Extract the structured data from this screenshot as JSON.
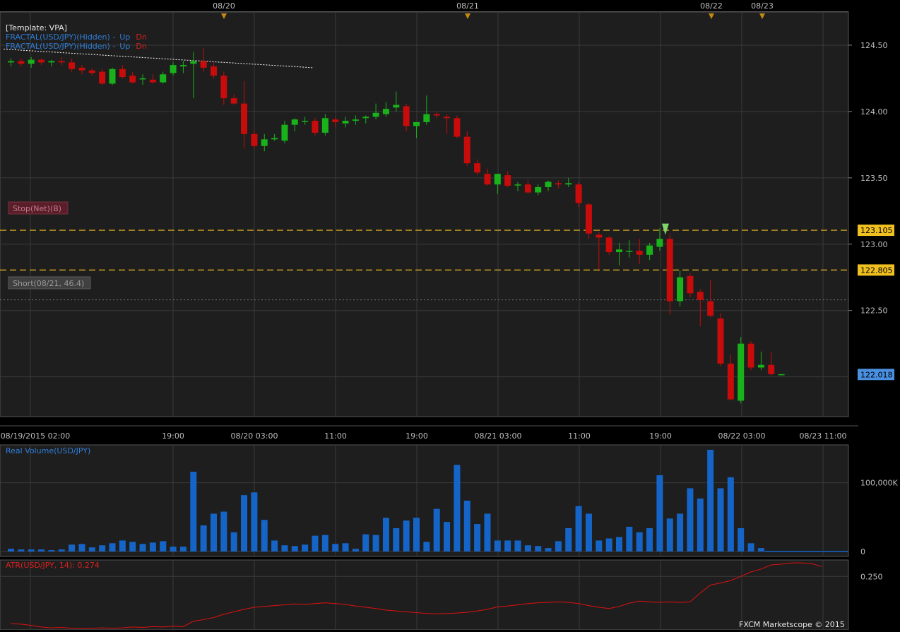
{
  "colors": {
    "background": "#000000",
    "panel": "#1e1e1e",
    "grid": "#3a3a3a",
    "border": "#555555",
    "up": "#19b21b",
    "down": "#c80b0b",
    "volume": "#1565c8",
    "atr": "#e01010",
    "level_line": "#f0c020",
    "price_badge": "#4a90e2",
    "text": "#bdbdbd",
    "marker": "#c28a10"
  },
  "top_dates": [
    "08/20",
    "08/21",
    "08/22",
    "08/23"
  ],
  "legend": {
    "template": "[Template: VPA]",
    "fractal_1": "FRACTAL(USD/JPY)(Hidden) -",
    "fractal_2": "FRACTAL(USD/JPY)(Hidden) -",
    "up": "Up",
    "dn": "Dn"
  },
  "orders": {
    "stop": "Stop(Net)(B)",
    "short": "Short(08/21, 46.4)"
  },
  "volume_title": "Real Volume(USD/JPY)",
  "atr_title": "ATR(USD/JPY, 14): 0.274",
  "watermark": "FXCM Marketscope © 2015",
  "chart_data": [
    {
      "type": "candlestick",
      "symbol": "USD/JPY",
      "x_labels": [
        "08/19/2015 02:00",
        "19:00",
        "08/20 03:00",
        "11:00",
        "19:00",
        "08/21 03:00",
        "11:00",
        "19:00",
        "08/22 03:00",
        "08/23 11:00"
      ],
      "y_ticks": [
        "124.50",
        "124.00",
        "123.50",
        "123.00",
        "122.50"
      ],
      "ylim": [
        121.7,
        124.75
      ],
      "levels": [
        {
          "label": "123.105",
          "value": 123.105
        },
        {
          "label": "122.805",
          "value": 122.805
        }
      ],
      "entry_level": 122.58,
      "last_price": "122.018",
      "candles": [
        [
          124.37,
          124.4,
          124.34,
          124.38
        ],
        [
          124.38,
          124.4,
          124.34,
          124.36
        ],
        [
          124.36,
          124.41,
          124.33,
          124.39
        ],
        [
          124.39,
          124.4,
          124.35,
          124.37
        ],
        [
          124.37,
          124.39,
          124.34,
          124.38
        ],
        [
          124.38,
          124.41,
          124.35,
          124.37
        ],
        [
          124.37,
          124.4,
          124.3,
          124.32
        ],
        [
          124.33,
          124.35,
          124.28,
          124.31
        ],
        [
          124.31,
          124.33,
          124.27,
          124.29
        ],
        [
          124.3,
          124.32,
          124.2,
          124.21
        ],
        [
          124.21,
          124.33,
          124.2,
          124.32
        ],
        [
          124.32,
          124.35,
          124.25,
          124.26
        ],
        [
          124.27,
          124.3,
          124.21,
          124.22
        ],
        [
          124.25,
          124.28,
          124.2,
          124.25
        ],
        [
          124.24,
          124.28,
          124.21,
          124.22
        ],
        [
          124.22,
          124.3,
          124.21,
          124.28
        ],
        [
          124.29,
          124.37,
          124.27,
          124.35
        ],
        [
          124.34,
          124.38,
          124.29,
          124.35
        ],
        [
          124.36,
          124.45,
          124.1,
          124.38
        ],
        [
          124.38,
          124.48,
          124.3,
          124.33
        ],
        [
          124.34,
          124.37,
          124.25,
          124.27
        ],
        [
          124.27,
          124.3,
          124.05,
          124.1
        ],
        [
          124.1,
          124.13,
          124.05,
          124.06
        ],
        [
          124.06,
          124.23,
          123.72,
          123.83
        ],
        [
          123.83,
          123.86,
          123.72,
          123.74
        ],
        [
          123.74,
          123.83,
          123.7,
          123.79
        ],
        [
          123.79,
          123.83,
          123.78,
          123.8
        ],
        [
          123.78,
          123.93,
          123.76,
          123.9
        ],
        [
          123.9,
          123.95,
          123.85,
          123.94
        ],
        [
          123.93,
          123.96,
          123.9,
          123.93
        ],
        [
          123.93,
          123.95,
          123.82,
          123.84
        ],
        [
          123.84,
          123.98,
          123.82,
          123.95
        ],
        [
          123.94,
          123.96,
          123.88,
          123.92
        ],
        [
          123.91,
          123.96,
          123.88,
          123.93
        ],
        [
          123.93,
          123.97,
          123.9,
          123.94
        ],
        [
          123.95,
          123.97,
          123.91,
          123.96
        ],
        [
          123.96,
          124.06,
          123.94,
          123.99
        ],
        [
          123.98,
          124.07,
          123.96,
          124.02
        ],
        [
          124.03,
          124.15,
          124.0,
          124.05
        ],
        [
          124.04,
          124.06,
          123.85,
          123.89
        ],
        [
          123.89,
          123.92,
          123.8,
          123.92
        ],
        [
          123.92,
          124.12,
          123.9,
          123.98
        ],
        [
          123.98,
          124.0,
          123.95,
          123.97
        ],
        [
          123.96,
          123.98,
          123.83,
          123.95
        ],
        [
          123.95,
          123.97,
          123.8,
          123.81
        ],
        [
          123.81,
          123.85,
          123.59,
          123.61
        ],
        [
          123.61,
          123.64,
          123.52,
          123.54
        ],
        [
          123.53,
          123.57,
          123.44,
          123.45
        ],
        [
          123.45,
          123.53,
          123.38,
          123.53
        ],
        [
          123.52,
          123.55,
          123.43,
          123.44
        ],
        [
          123.45,
          123.47,
          123.4,
          123.45
        ],
        [
          123.45,
          123.48,
          123.38,
          123.39
        ],
        [
          123.39,
          123.45,
          123.37,
          123.43
        ],
        [
          123.43,
          123.48,
          123.4,
          123.47
        ],
        [
          123.46,
          123.48,
          123.42,
          123.45
        ],
        [
          123.45,
          123.5,
          123.43,
          123.46
        ],
        [
          123.45,
          123.47,
          123.28,
          123.31
        ],
        [
          123.3,
          123.31,
          123.04,
          123.08
        ],
        [
          123.07,
          123.09,
          122.81,
          123.05
        ],
        [
          123.05,
          123.06,
          122.92,
          122.94
        ],
        [
          122.94,
          123.01,
          122.84,
          122.96
        ],
        [
          122.95,
          123.03,
          122.9,
          122.95
        ],
        [
          122.95,
          123.04,
          122.85,
          122.92
        ],
        [
          122.92,
          123.01,
          122.88,
          122.99
        ],
        [
          122.98,
          123.12,
          122.95,
          123.04
        ],
        [
          123.04,
          123.08,
          122.47,
          122.57
        ],
        [
          122.57,
          122.8,
          122.53,
          122.75
        ],
        [
          122.76,
          122.78,
          122.6,
          122.63
        ],
        [
          122.64,
          122.66,
          122.38,
          122.58
        ],
        [
          122.57,
          122.73,
          122.45,
          122.46
        ],
        [
          122.44,
          122.48,
          122.08,
          122.1
        ],
        [
          122.1,
          122.17,
          121.82,
          121.83
        ],
        [
          121.82,
          122.3,
          121.8,
          122.25
        ],
        [
          122.25,
          122.27,
          122.05,
          122.07
        ],
        [
          122.07,
          122.19,
          122.05,
          122.09
        ],
        [
          122.09,
          122.19,
          122.01,
          122.02
        ],
        [
          122.02,
          122.02,
          122.01,
          122.02
        ]
      ]
    },
    {
      "type": "bar",
      "name": "Real Volume(USD/JPY)",
      "ylim": [
        0,
        150000
      ],
      "y_ticks": [
        "100,000K",
        "0"
      ],
      "values": [
        4000,
        3000,
        3000,
        3000,
        2000,
        3000,
        10000,
        11000,
        6000,
        9000,
        12000,
        16000,
        14000,
        11000,
        13000,
        15000,
        7000,
        7000,
        116000,
        38000,
        55000,
        58000,
        28000,
        82000,
        86000,
        46000,
        16000,
        9000,
        8000,
        10000,
        23000,
        24000,
        11000,
        12000,
        4000,
        25000,
        24000,
        49000,
        34000,
        45000,
        49000,
        14000,
        62000,
        43000,
        126000,
        74000,
        40000,
        55000,
        16000,
        16000,
        16000,
        9000,
        8000,
        5000,
        15000,
        34000,
        66000,
        55000,
        16000,
        19000,
        21000,
        36000,
        28000,
        34000,
        111000,
        48000,
        55000,
        92000,
        77000,
        148000,
        92000,
        108000,
        34000,
        12000,
        5000
      ]
    },
    {
      "type": "line",
      "name": "ATR(USD/JPY, 14)",
      "value_label": "0.274",
      "ylim": [
        0.12,
        0.29
      ],
      "y_ticks": [
        "0.250"
      ],
      "values": [
        0.135,
        0.134,
        0.131,
        0.127,
        0.125,
        0.126,
        0.124,
        0.123,
        0.124,
        0.125,
        0.124,
        0.125,
        0.127,
        0.126,
        0.128,
        0.127,
        0.129,
        0.128,
        0.141,
        0.145,
        0.15,
        0.158,
        0.164,
        0.17,
        0.175,
        0.177,
        0.179,
        0.181,
        0.183,
        0.182,
        0.184,
        0.186,
        0.184,
        0.182,
        0.178,
        0.175,
        0.172,
        0.168,
        0.166,
        0.164,
        0.162,
        0.16,
        0.159,
        0.16,
        0.161,
        0.163,
        0.166,
        0.17,
        0.176,
        0.178,
        0.181,
        0.184,
        0.186,
        0.187,
        0.188,
        0.187,
        0.184,
        0.179,
        0.175,
        0.172,
        0.177,
        0.185,
        0.19,
        0.188,
        0.187,
        0.188,
        0.187,
        0.188,
        0.21,
        0.229,
        0.234,
        0.24,
        0.25,
        0.261,
        0.268,
        0.278,
        0.28,
        0.283,
        0.283,
        0.281,
        0.274
      ]
    }
  ]
}
